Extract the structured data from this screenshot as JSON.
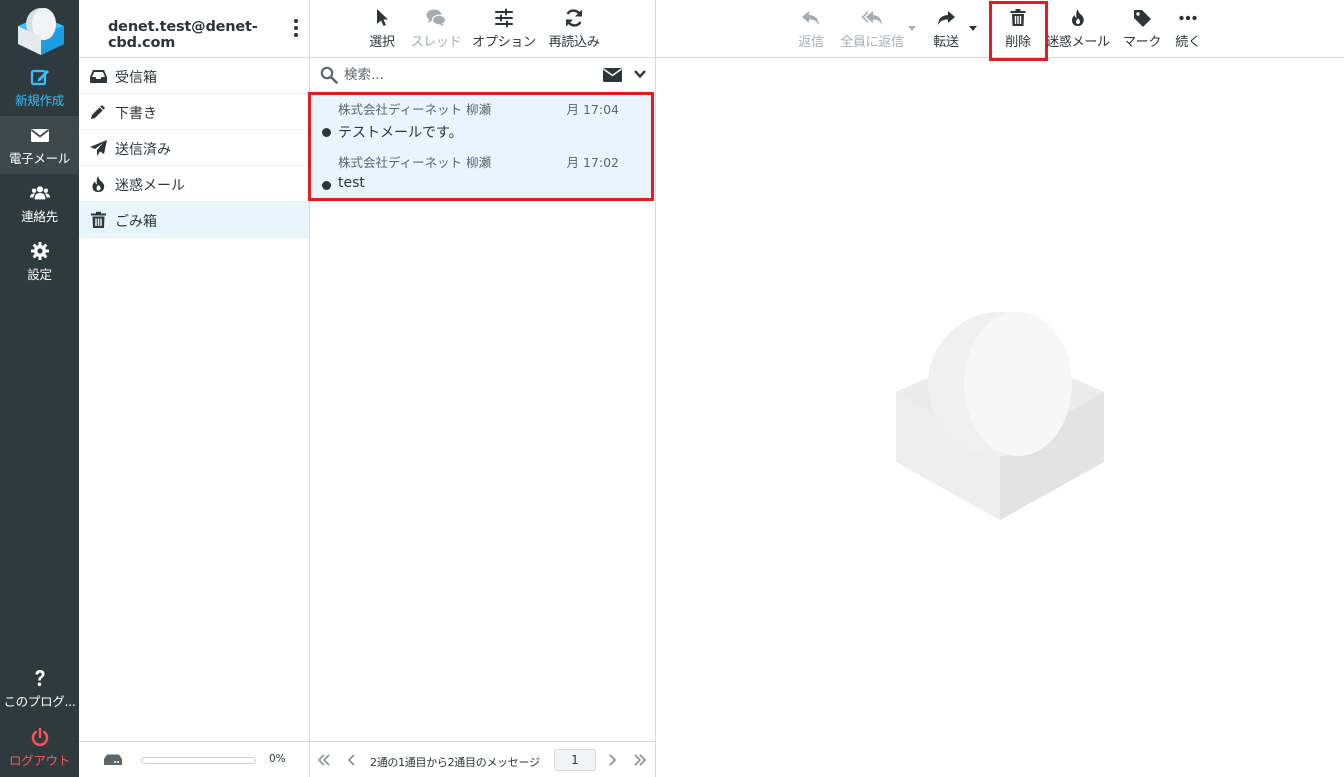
{
  "nav": {
    "items": [
      {
        "label": "新規作成",
        "icon": "compose-icon"
      },
      {
        "label": "電子メール",
        "icon": "envelope-icon"
      },
      {
        "label": "連絡先",
        "icon": "users-icon"
      },
      {
        "label": "設定",
        "icon": "gear-icon"
      }
    ],
    "about_label": "このプログ...",
    "logout_label": "ログアウト"
  },
  "account": {
    "email": "denet.test@denet-cbd.com"
  },
  "folders": [
    {
      "label": "受信箱",
      "icon": "inbox-icon"
    },
    {
      "label": "下書き",
      "icon": "pencil-icon"
    },
    {
      "label": "送信済み",
      "icon": "paper-plane-icon"
    },
    {
      "label": "迷惑メール",
      "icon": "fire-icon"
    },
    {
      "label": "ごみ箱",
      "icon": "trash-icon",
      "active": true
    }
  ],
  "quota": {
    "percent_label": "0%",
    "fraction": 0
  },
  "list_toolbar": {
    "select": "選択",
    "threads": "スレッド",
    "options": "オプション",
    "refresh": "再読込み"
  },
  "search": {
    "placeholder": "検索..."
  },
  "messages": [
    {
      "from": "株式会社ディーネット 柳瀬",
      "date": "月 17:04",
      "subject": "テストメールです。",
      "unread": true
    },
    {
      "from": "株式会社ディーネット 柳瀬",
      "date": "月 17:02",
      "subject": "test",
      "unread": true
    }
  ],
  "pager": {
    "text": "2通の1通目から2通目のメッセージ",
    "page": "1"
  },
  "main_toolbar": {
    "reply": "返信",
    "reply_all": "全員に返信",
    "forward": "転送",
    "delete": "削除",
    "spam": "迷惑メール",
    "mark": "マーク",
    "more": "続く"
  },
  "colors": {
    "accent": "#37beff",
    "highlight": "#e31b23",
    "nav_bg": "#2f3a3f",
    "selected_bg": "#e8f5fc"
  }
}
